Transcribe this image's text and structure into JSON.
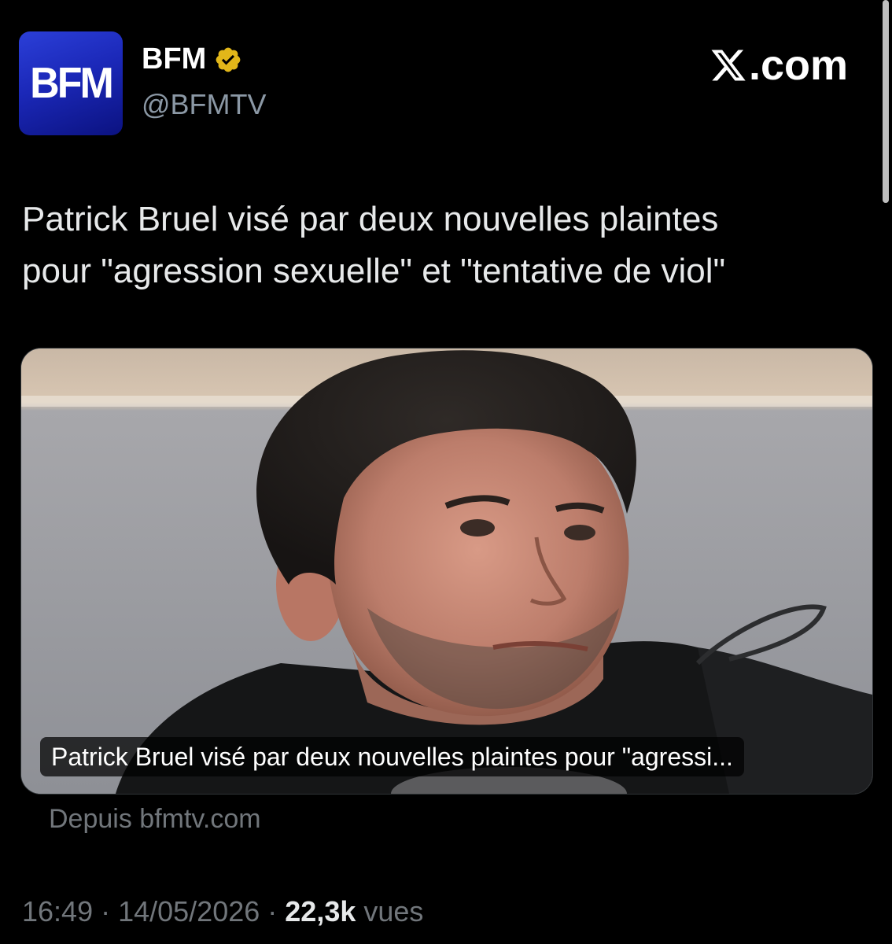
{
  "header": {
    "avatar_text": "BFM",
    "display_name": "BFM",
    "handle": "@BFMTV",
    "site_label": ".com"
  },
  "tweet": {
    "text": "Patrick Bruel visé par deux nouvelles plaintes\npour \"agression sexuelle\" et \"tentative de viol\"",
    "card_caption": "Patrick Bruel visé par deux nouvelles plaintes pour \"agressi...",
    "source": "Depuis bfmtv.com",
    "time": "16:49",
    "date": "14/05/2026",
    "separator": " · ",
    "views_count": "22,3k",
    "views_label": "vues"
  },
  "colors": {
    "background": "#000000",
    "text_primary": "#e7e9ea",
    "text_secondary": "#71767b",
    "verified_badge": "#e2b719",
    "avatar_blue": "#1b28b8"
  },
  "icons": {
    "verified": "verified-badge-icon",
    "x_logo": "x-logo-icon"
  }
}
